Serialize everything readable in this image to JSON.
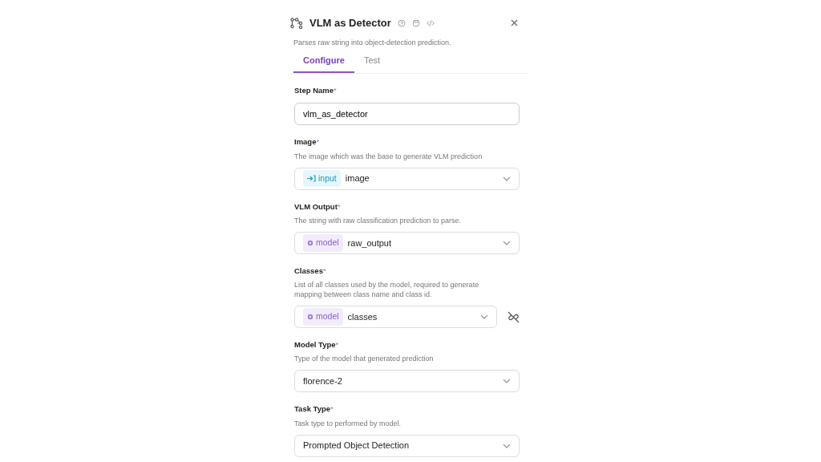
{
  "header": {
    "title": "VLM as Detector",
    "description": "Parses raw string into object-detection prediction."
  },
  "tabs": [
    {
      "label": "Configure",
      "selected": true
    },
    {
      "label": "Test",
      "selected": false
    }
  ],
  "fields": [
    {
      "kind": "text",
      "label": "Step Name",
      "required_mark": "*",
      "value": "vlm_as_detector"
    },
    {
      "kind": "select",
      "label": "Image",
      "required_mark": "*",
      "description": "The image which was the base to generate VLM prediction",
      "tag": {
        "kind": "input",
        "label": "input"
      },
      "value": "image"
    },
    {
      "kind": "select",
      "label": "VLM Output",
      "required_mark": "*",
      "description": "The string with raw classification prediction to parse.",
      "tag": {
        "kind": "model",
        "label": "model"
      },
      "value": "raw_output"
    },
    {
      "kind": "select",
      "label": "Classes",
      "required_mark": "*",
      "description": "List of all classes used by the model, required to generate mapping between class name and class id.",
      "tag": {
        "kind": "model",
        "label": "model"
      },
      "value": "classes",
      "unlink": true
    },
    {
      "kind": "select",
      "label": "Model Type",
      "required_mark": "*",
      "description": "Type of the model that generated prediction",
      "value": "florence-2"
    },
    {
      "kind": "select",
      "label": "Task Type",
      "required_mark": "*",
      "description": "Task type to performed by model.",
      "value": "Prompted Object Detection"
    }
  ]
}
